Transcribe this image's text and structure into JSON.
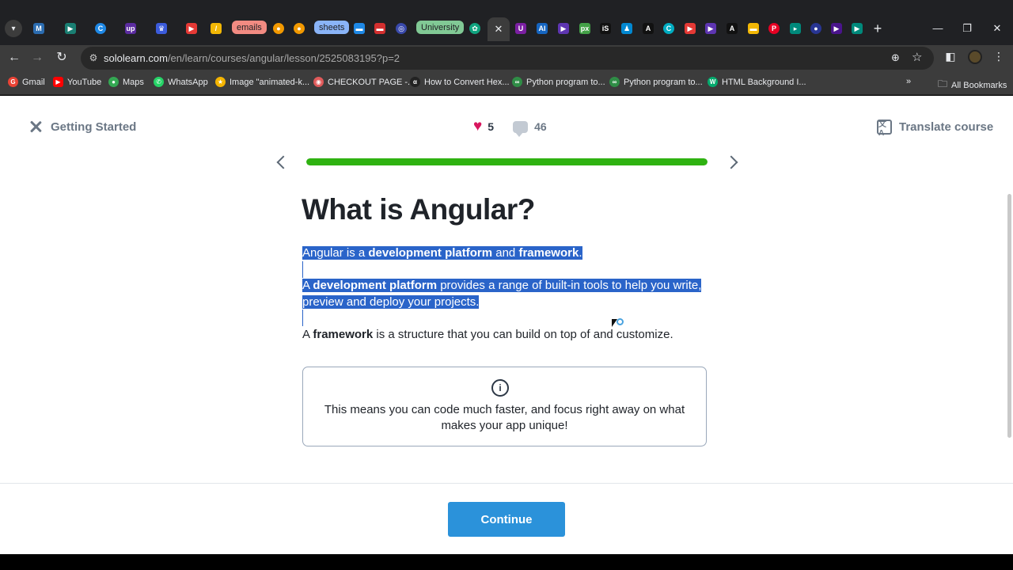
{
  "browser": {
    "tab_groups": [
      {
        "label": "emails",
        "color": "#f28b82"
      },
      {
        "label": "sheets",
        "color": "#8ab4f8"
      },
      {
        "label": "University",
        "color": "#81c995"
      }
    ],
    "active_tab_close": "✕",
    "new_tab": "+",
    "url_host": "sololearn.com",
    "url_path": "/en/learn/courses/angular/lesson/2525083195?p=2",
    "bookmarks": [
      {
        "label": "Gmail",
        "icon": "gmail-icon",
        "color": "#ea4335"
      },
      {
        "label": "YouTube",
        "icon": "youtube-icon",
        "color": "#ff0000"
      },
      {
        "label": "Maps",
        "icon": "maps-icon",
        "color": "#34a853"
      },
      {
        "label": "WhatsApp",
        "icon": "whatsapp-icon",
        "color": "#25d366"
      },
      {
        "label": "Image \"animated-k...",
        "icon": "star-icon",
        "color": "#f4b400"
      },
      {
        "label": "CHECKOUT PAGE -...",
        "icon": "cart-icon",
        "color": "#e05a5a"
      },
      {
        "label": "How to Convert Hex...",
        "icon": "alpha-icon",
        "color": "#222222"
      },
      {
        "label": "Python program to...",
        "icon": "gfg-icon",
        "color": "#2f8d46"
      },
      {
        "label": "Python program to...",
        "icon": "gfg-icon",
        "color": "#2f8d46"
      },
      {
        "label": "HTML Background I...",
        "icon": "w3-icon",
        "color": "#04aa6d"
      }
    ],
    "all_bookmarks": "All Bookmarks"
  },
  "header": {
    "course_title": "Getting Started",
    "likes": "5",
    "comments": "46",
    "translate_label": "Translate course"
  },
  "progress": {
    "fraction": 1.0
  },
  "lesson": {
    "title": "What is Angular?",
    "p1": {
      "a": "Angular is a ",
      "b": "development platform",
      "c": " and ",
      "d": "framework",
      "e": "."
    },
    "p2": {
      "a": "A ",
      "b": "development platform",
      "c": " provides a range of built-in tools to help you write,",
      "d": "preview and deploy your projects."
    },
    "p3": {
      "a": "A ",
      "b": "framework",
      "c": " is a structure that you can build on top of and customize."
    },
    "tip_icon": "i",
    "tip_text": "This means you can code much faster, and focus right away on what makes your app unique!"
  },
  "footer": {
    "continue_label": "Continue"
  },
  "colors": {
    "accent_blue": "#2b92da",
    "progress_green": "#2fb211",
    "heart_red": "#d8175e",
    "selection": "#2a64c9"
  }
}
